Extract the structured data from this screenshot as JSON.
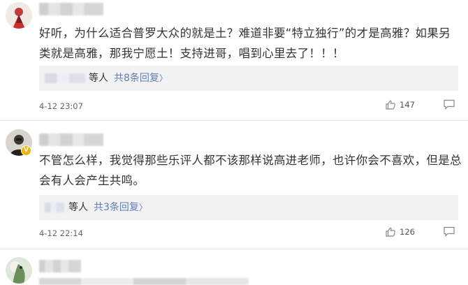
{
  "comments": [
    {
      "text": "好听，为什么适合普罗大众的就是土？难道非要“特立独行”的才是高雅？如果另类就是高雅，那我宁愿土！支持进哥，唱到心里去了！！！",
      "reply_suffix": "等人",
      "reply_link": "共8条回复",
      "chevron": "〉",
      "time": "4-12 23:07",
      "likes": "147",
      "like_icon": "thumbs-up-icon",
      "reply_icon": "comment-bubble-icon"
    },
    {
      "text": "不管怎么样，我觉得那些乐评人都不该那样说高进老师，也许你会不喜欢，但是总会有人会产生共鸣。",
      "reply_suffix": "等人",
      "reply_link": "共3条回复",
      "chevron": "〉",
      "time": "4-12 22:14",
      "likes": "126",
      "like_icon": "thumbs-up-icon",
      "reply_icon": "comment-bubble-icon",
      "verified_badge": "V"
    }
  ],
  "colors": {
    "link": "#5d7fb9",
    "reply_bg": "#f2f2f2",
    "badge": "#f2b600"
  }
}
